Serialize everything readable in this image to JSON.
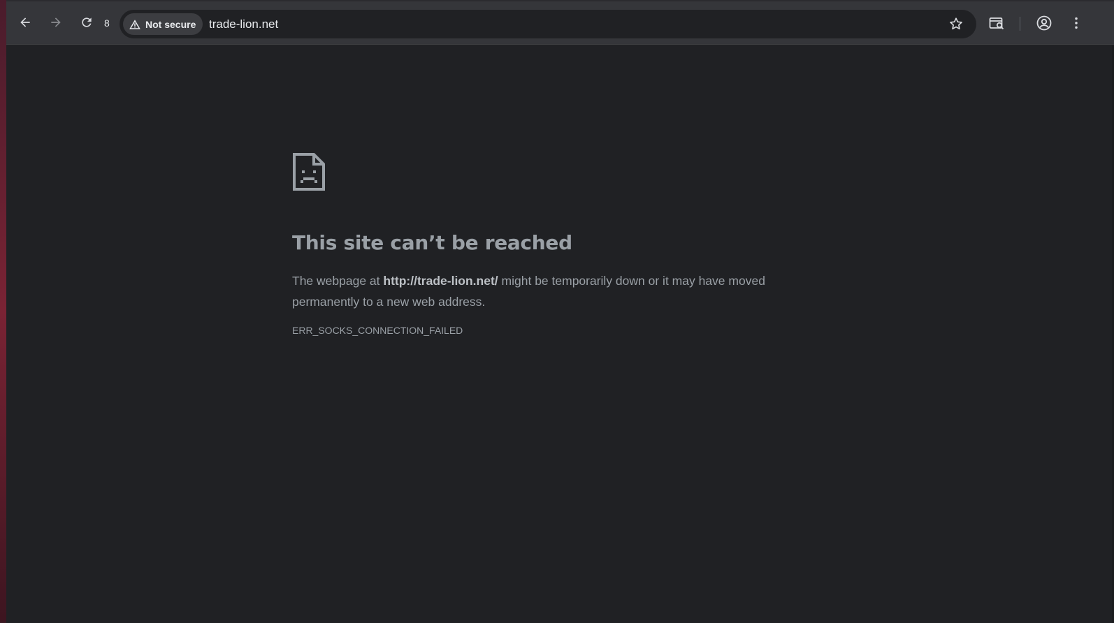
{
  "toolbar": {
    "reload_count": "8",
    "security_label": "Not secure",
    "url": "trade-lion.net"
  },
  "error_page": {
    "headline": "This site can’t be reached",
    "message_prefix": "The webpage at ",
    "message_url": "http://trade-lion.net/",
    "message_suffix": " might be temporarily down or it may have moved permanently to a new web address.",
    "error_code": "ERR_SOCKS_CONNECTION_FAILED"
  },
  "colors": {
    "page_bg": "#202124",
    "toolbar_bg": "#35363a",
    "text_muted": "#9aa0a6"
  }
}
